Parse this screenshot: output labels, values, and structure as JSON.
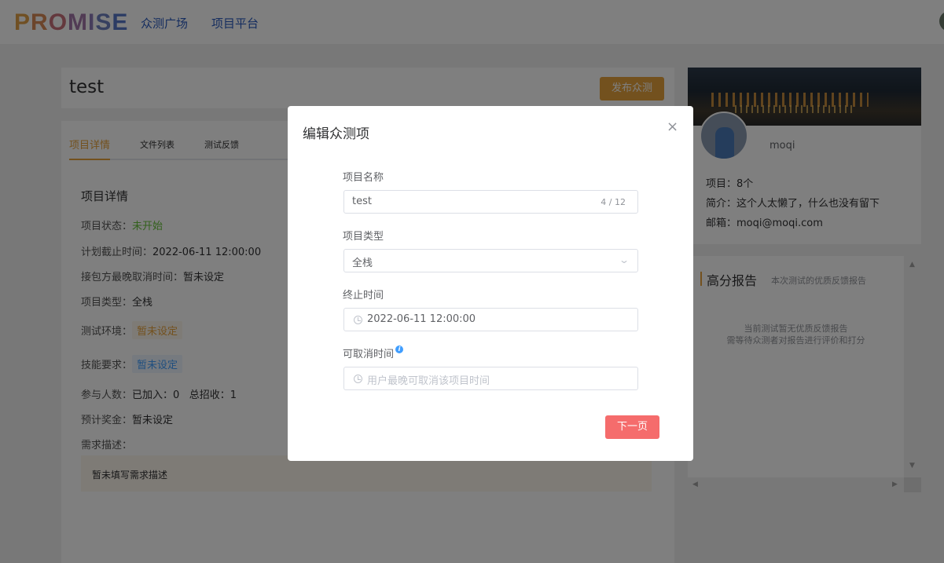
{
  "nav": {
    "logo_letters": [
      "P",
      "R",
      "O",
      "M",
      "I",
      "S",
      "E"
    ],
    "links": [
      "众测广场",
      "项目平台"
    ]
  },
  "project": {
    "title": "test",
    "publish_label": "发布众测",
    "tabs": [
      "项目详情",
      "文件列表",
      "测试反馈"
    ],
    "section_title": "项目详情",
    "status_label": "项目状态：",
    "status_value": "未开始",
    "deadline_label": "计划截止时间：",
    "deadline_value": "2022-06-11 12:00:00",
    "cancel_label": "接包方最晚取消时间：",
    "cancel_value": "暂未设定",
    "type_label": "项目类型：",
    "type_value": "全栈",
    "env_label": "测试环境：",
    "env_value": "暂未设定",
    "skill_label": "技能要求：",
    "skill_value": "暂未设定",
    "people_label": "参与人数：",
    "people_joined": "已加入：0",
    "people_total": "总招收：1",
    "bonus_label": "预计奖金：",
    "bonus_value": "暂未设定",
    "desc_label": "需求描述：",
    "desc_value": "暂未填写需求描述"
  },
  "profile": {
    "name": "moqi",
    "projects": "项目：8个",
    "intro": "简介：这个人太懒了，什么也没有留下",
    "email": "邮箱：moqi@moqi.com"
  },
  "report": {
    "title": "高分报告",
    "subtitle": "本次测试的优质反馈报告",
    "empty_line1": "当前测试暂无优质反馈报告",
    "empty_line2": "需等待众测者对报告进行评价和打分"
  },
  "modal": {
    "title": "编辑众测项",
    "close": "×",
    "name_label": "项目名称",
    "name_value": "test",
    "name_count": "4 / 12",
    "type_label": "项目类型",
    "type_value": "全栈",
    "end_label": "终止时间",
    "end_value": "2022-06-11 12:00:00",
    "cancel_label": "可取消时间",
    "cancel_placeholder": "用户最晚可取消该项目时间",
    "next_label": "下一页"
  },
  "colors": {
    "accent": "#e6a23c",
    "primary": "#409eff",
    "danger": "#f56c6c",
    "success": "#67c23a",
    "nav_link": "#2a5bbf"
  }
}
